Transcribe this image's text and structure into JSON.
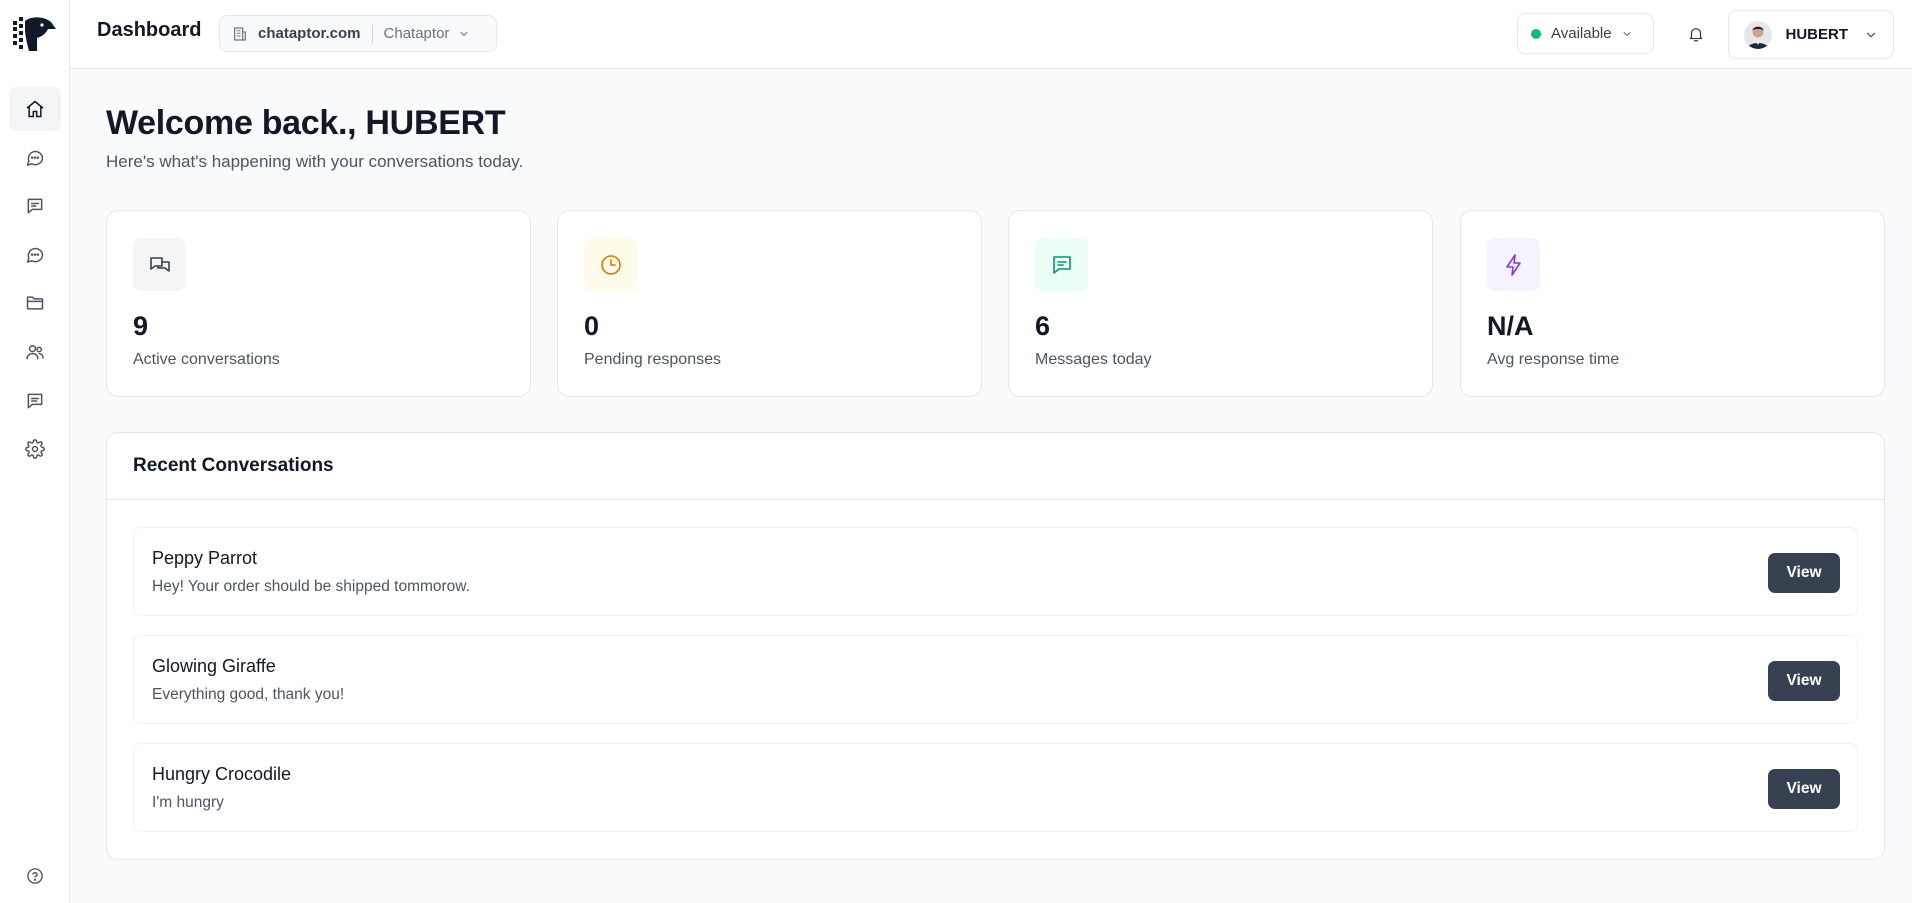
{
  "header": {
    "title": "Dashboard",
    "org": {
      "domain": "chataptor.com",
      "name": "Chataptor"
    },
    "status": {
      "label": "Available",
      "color": "#10b981"
    },
    "user": {
      "name": "HUBERT"
    }
  },
  "sidebar": {
    "items": [
      {
        "icon": "home-icon",
        "active": true
      },
      {
        "icon": "chat-bubble-icon"
      },
      {
        "icon": "message-square-icon"
      },
      {
        "icon": "chat-dots-icon"
      },
      {
        "icon": "folder-icon"
      },
      {
        "icon": "users-icon"
      },
      {
        "icon": "message-lines-icon"
      },
      {
        "icon": "settings-icon"
      }
    ],
    "help_icon": "help-icon"
  },
  "welcome": {
    "title": "Welcome back., HUBERT",
    "subtitle": "Here's what's happening with your conversations today."
  },
  "stats": [
    {
      "value": "9",
      "label": "Active conversations",
      "icon": "conversations-icon",
      "bg": "#f3f4f6",
      "color": "#374151"
    },
    {
      "value": "0",
      "label": "Pending responses",
      "icon": "clock-icon",
      "bg": "#fffbeb",
      "color": "#d97706"
    },
    {
      "value": "6",
      "label": "Messages today",
      "icon": "message-icon",
      "bg": "#ecfdf5",
      "color": "#059669"
    },
    {
      "value": "N/A",
      "label": "Avg response time",
      "icon": "lightning-icon",
      "bg": "#f5f3ff",
      "color": "#7c3aed"
    }
  ],
  "recent": {
    "title": "Recent Conversations",
    "items": [
      {
        "name": "Peppy Parrot",
        "message": "Hey! Your order should be shipped tommorow.",
        "button": "View"
      },
      {
        "name": "Glowing Giraffe",
        "message": "Everything good, thank you!",
        "button": "View"
      },
      {
        "name": "Hungry Crocodile",
        "message": "I'm hungry",
        "button": "View"
      }
    ]
  }
}
